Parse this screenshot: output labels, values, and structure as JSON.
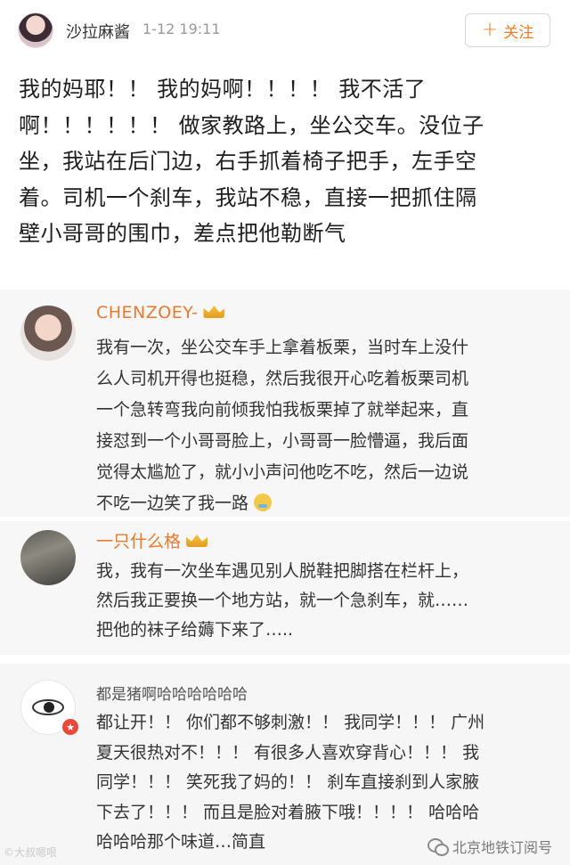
{
  "post": {
    "username": "沙拉麻酱",
    "timestamp": "1-12 19:11",
    "follow_label": "关注",
    "follow_icon": "+",
    "content_lines": [
      "我的妈耶！！ 我的妈啊！！！！ 我不活了",
      "啊！！！！！！ 做家教路上，坐公交车。没位子",
      "坐，我站在后门边，右手抓着椅子把手，左手空",
      "着。司机一个刹车，我站不稳，直接一把抓住隔",
      "壁小哥哥的围巾，差点把他勒断气"
    ]
  },
  "comments": [
    {
      "name": "CHENZOEY-",
      "badge_icon": "crown-icon",
      "text_lines": [
        "我有一次，坐公交车手上拿着板栗，当时车上没什",
        "么人司机开得也挺稳，然后我很开心吃着板栗司机",
        "一个急转弯我向前倾我怕我板栗掉了就举起来，直",
        "接怼到一个小哥哥脸上，小哥哥一脸懵逼，我后面",
        "觉得太尴尬了，就小小声问他吃不吃，然后一边说",
        "不吃一边笑了我一路"
      ]
    },
    {
      "name": "一只什么格",
      "badge_icon": "crown-icon",
      "text_lines": [
        "我，我有一次坐车遇见别人脱鞋把脚搭在栏杆上，",
        "然后我正要换一个地方站，就一个急刹车，就……",
        "把他的袜子给薅下来了….."
      ]
    },
    {
      "name": "都是猪啊哈哈哈哈哈哈",
      "text_lines": [
        "都让开！！ 你们都不够刺激！！ 我同学！！！ 广州",
        "夏天很热对不！！！ 有很多人喜欢穿背心！！！ 我",
        "同学！！！ 笑死我了妈的！！ 刹车直接刹到人家腋",
        "下去了！！！ 而且是脸对着腋下哦！！！！ 哈哈哈",
        "哈哈哈那个味道…简直"
      ]
    }
  ],
  "watermarks": {
    "left": "©大叔嗯哏",
    "right": "北京地铁订阅号"
  }
}
